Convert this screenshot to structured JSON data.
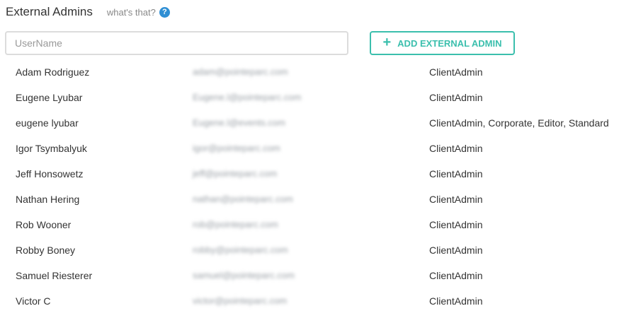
{
  "header": {
    "title": "External Admins",
    "whats_that": "what's that?",
    "help_glyph": "?"
  },
  "search": {
    "placeholder": "UserName",
    "value": ""
  },
  "add_button": {
    "icon": "plus-icon",
    "label": "ADD EXTERNAL ADMIN"
  },
  "colors": {
    "accent": "#3bbfad",
    "help_icon": "#2f8fd4"
  },
  "admins": [
    {
      "name": "Adam Rodriguez",
      "email": "adam@pointeparc.com",
      "roles": "ClientAdmin"
    },
    {
      "name": "Eugene Lyubar",
      "email": "Eugene.l@pointeparc.com",
      "roles": "ClientAdmin"
    },
    {
      "name": "eugene lyubar",
      "email": "Eugene.l@events.com",
      "roles": "ClientAdmin, Corporate, Editor, Standard"
    },
    {
      "name": "Igor Tsymbalyuk",
      "email": "igor@pointeparc.com",
      "roles": "ClientAdmin"
    },
    {
      "name": "Jeff Honsowetz",
      "email": "jeff@pointeparc.com",
      "roles": "ClientAdmin"
    },
    {
      "name": "Nathan Hering",
      "email": "nathan@pointeparc.com",
      "roles": "ClientAdmin"
    },
    {
      "name": "Rob Wooner",
      "email": "rob@pointeparc.com",
      "roles": "ClientAdmin"
    },
    {
      "name": "Robby Boney",
      "email": "robby@pointeparc.com",
      "roles": "ClientAdmin"
    },
    {
      "name": "Samuel Riesterer",
      "email": "samuel@pointeparc.com",
      "roles": "ClientAdmin"
    },
    {
      "name": "Victor C",
      "email": "victor@pointeparc.com",
      "roles": "ClientAdmin"
    }
  ]
}
